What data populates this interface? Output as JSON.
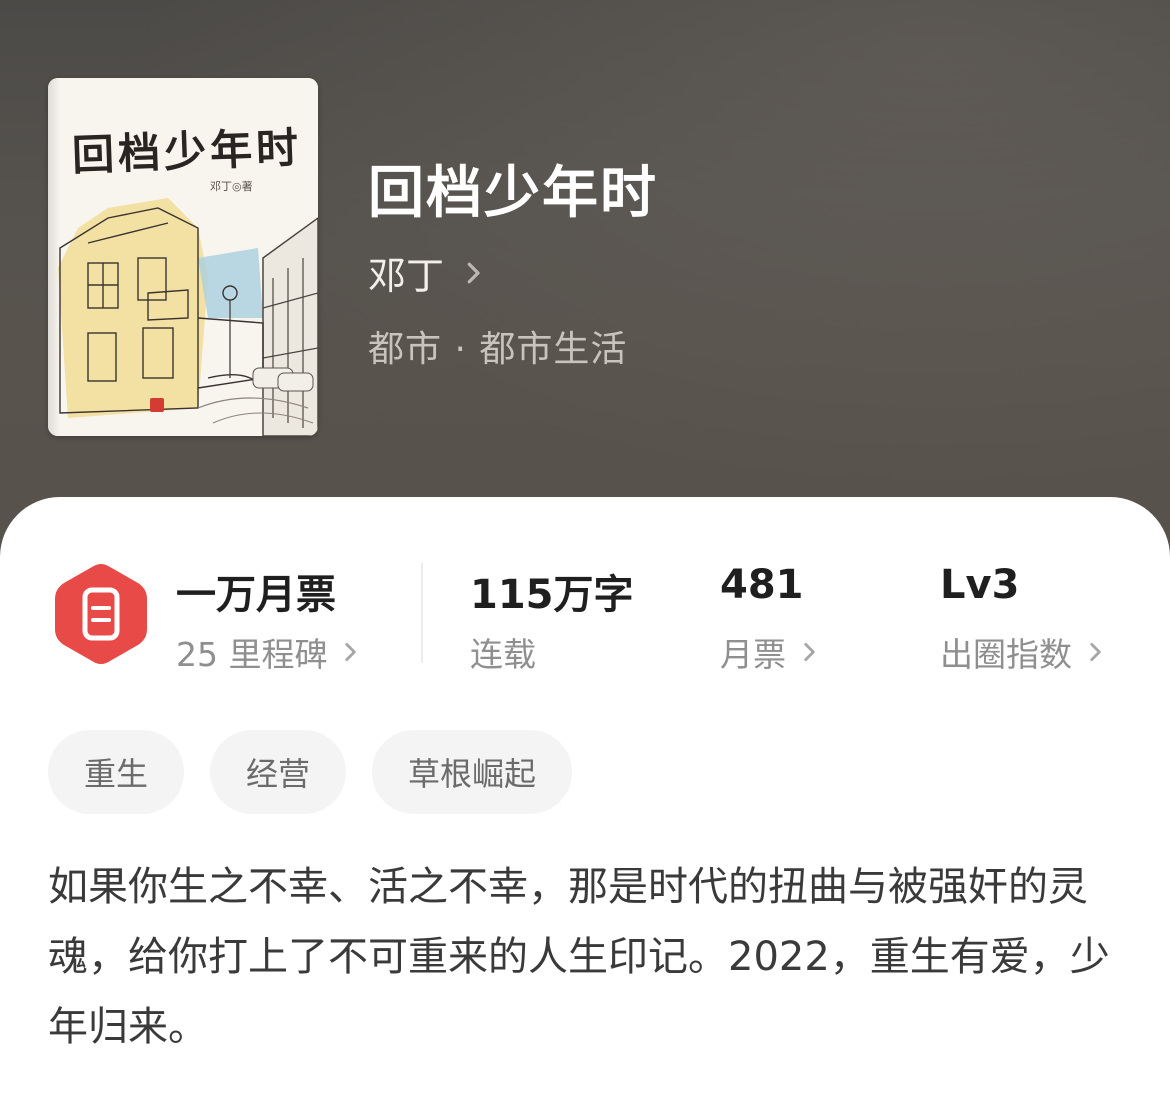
{
  "book": {
    "title": "回档少年时",
    "author": "邓丁",
    "genre": "都市 · 都市生活",
    "cover": {
      "title": "回档少年时",
      "author_line": "邓丁◎著"
    }
  },
  "stats": {
    "monthly_ticket_badge": {
      "main": "一万月票",
      "sub": "25 里程碑",
      "icon": "ticket-icon",
      "color": "#e84a47"
    },
    "word_count": {
      "main": "115万字",
      "sub": "连载"
    },
    "monthly_tickets": {
      "main": "481",
      "sub": "月票"
    },
    "popularity": {
      "main": "Lv3",
      "sub": "出圈指数"
    }
  },
  "tags": [
    "重生",
    "经营",
    "草根崛起"
  ],
  "description": "如果你生之不幸、活之不幸，那是时代的扭曲与被强奸的灵魂，给你打上了不可重来的人生印记。2022，重生有爱，少年归来。"
}
